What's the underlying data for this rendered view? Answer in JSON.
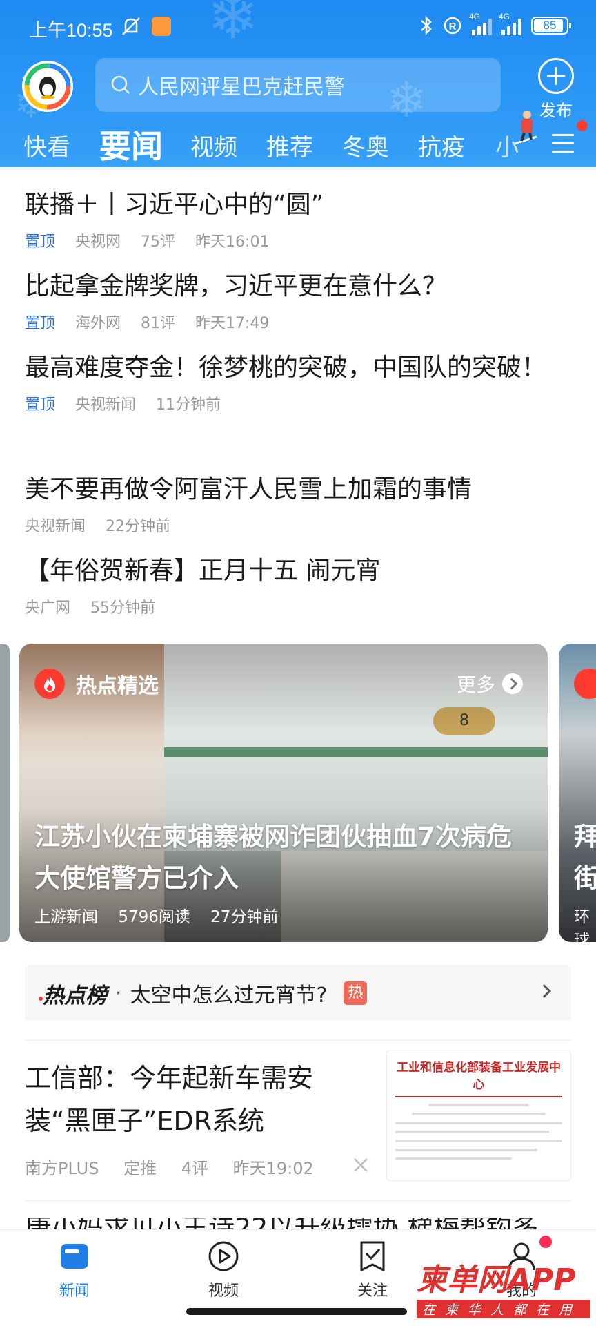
{
  "status_bar": {
    "time": "上午10:55",
    "sig1_label": "4G",
    "sig2_label": "4G",
    "battery": "85"
  },
  "header": {
    "search_placeholder": "人民网评星巴克赶民警",
    "publish_label": "发布",
    "tabs": [
      "快看",
      "要闻",
      "视频",
      "推荐",
      "冬奥",
      "抗疫",
      "小"
    ],
    "active_tab": "要闻"
  },
  "news": [
    {
      "title": "联播＋丨习近平心中的“圆”",
      "pinned": "置顶",
      "source": "央视网",
      "comments": "75评",
      "time": "昨天16:01"
    },
    {
      "title": "比起拿金牌奖牌，习近平更在意什么？",
      "pinned": "置顶",
      "source": "海外网",
      "comments": "81评",
      "time": "昨天17:49"
    },
    {
      "title": "最高难度夺金！徐梦桃的突破，中国队的突破！",
      "pinned": "置顶",
      "source": "央视新闻",
      "time": "11分钟前"
    },
    {
      "title": "美不要再做令阿富汗人民雪上加霜的事情",
      "source": "央视新闻",
      "time": "22分钟前"
    },
    {
      "title": "【年俗贺新春】正月十五 闹元宵",
      "source": "央广网",
      "time": "55分钟前"
    }
  ],
  "hot_card": {
    "label": "热点精选",
    "more": "更多",
    "bed_number": "8",
    "title": "江苏小伙在柬埔寨被网诈团伙抽血7次病危 大使馆警方已介入",
    "source": "上游新闻",
    "reads": "5796阅读",
    "time": "27分钟前",
    "peek_title": "拜\n街",
    "peek_source": "环球"
  },
  "hot_rank": {
    "logo": "热点榜",
    "dot": "·",
    "text": "太空中怎么过元宵节?",
    "badge": "热"
  },
  "article": {
    "title": "工信部：今年起新车需安装“黑匣子”EDR系统",
    "source": "南方PLUS",
    "tag": "定推",
    "comments": "4评",
    "time": "昨天19:02",
    "thumb_heading": "工业和信息化部装备工业发展中心"
  },
  "next_article_partial": "康小妈求见小王诗22以升级擂协 梯梅帮钩多",
  "bottom_nav": [
    {
      "label": "新闻",
      "icon": "news-icon"
    },
    {
      "label": "视频",
      "icon": "video-play-icon"
    },
    {
      "label": "关注",
      "icon": "follow-check-icon"
    },
    {
      "label": "我的",
      "icon": "profile-icon"
    }
  ],
  "watermark": {
    "main": "柬单网APP",
    "sub": "在柬华人都在用"
  },
  "colors": {
    "header_blue": "#1e8af2",
    "accent_blue": "#1f7ee8",
    "hot_red": "#ff3b30",
    "pin_blue": "#2a6fd8"
  }
}
